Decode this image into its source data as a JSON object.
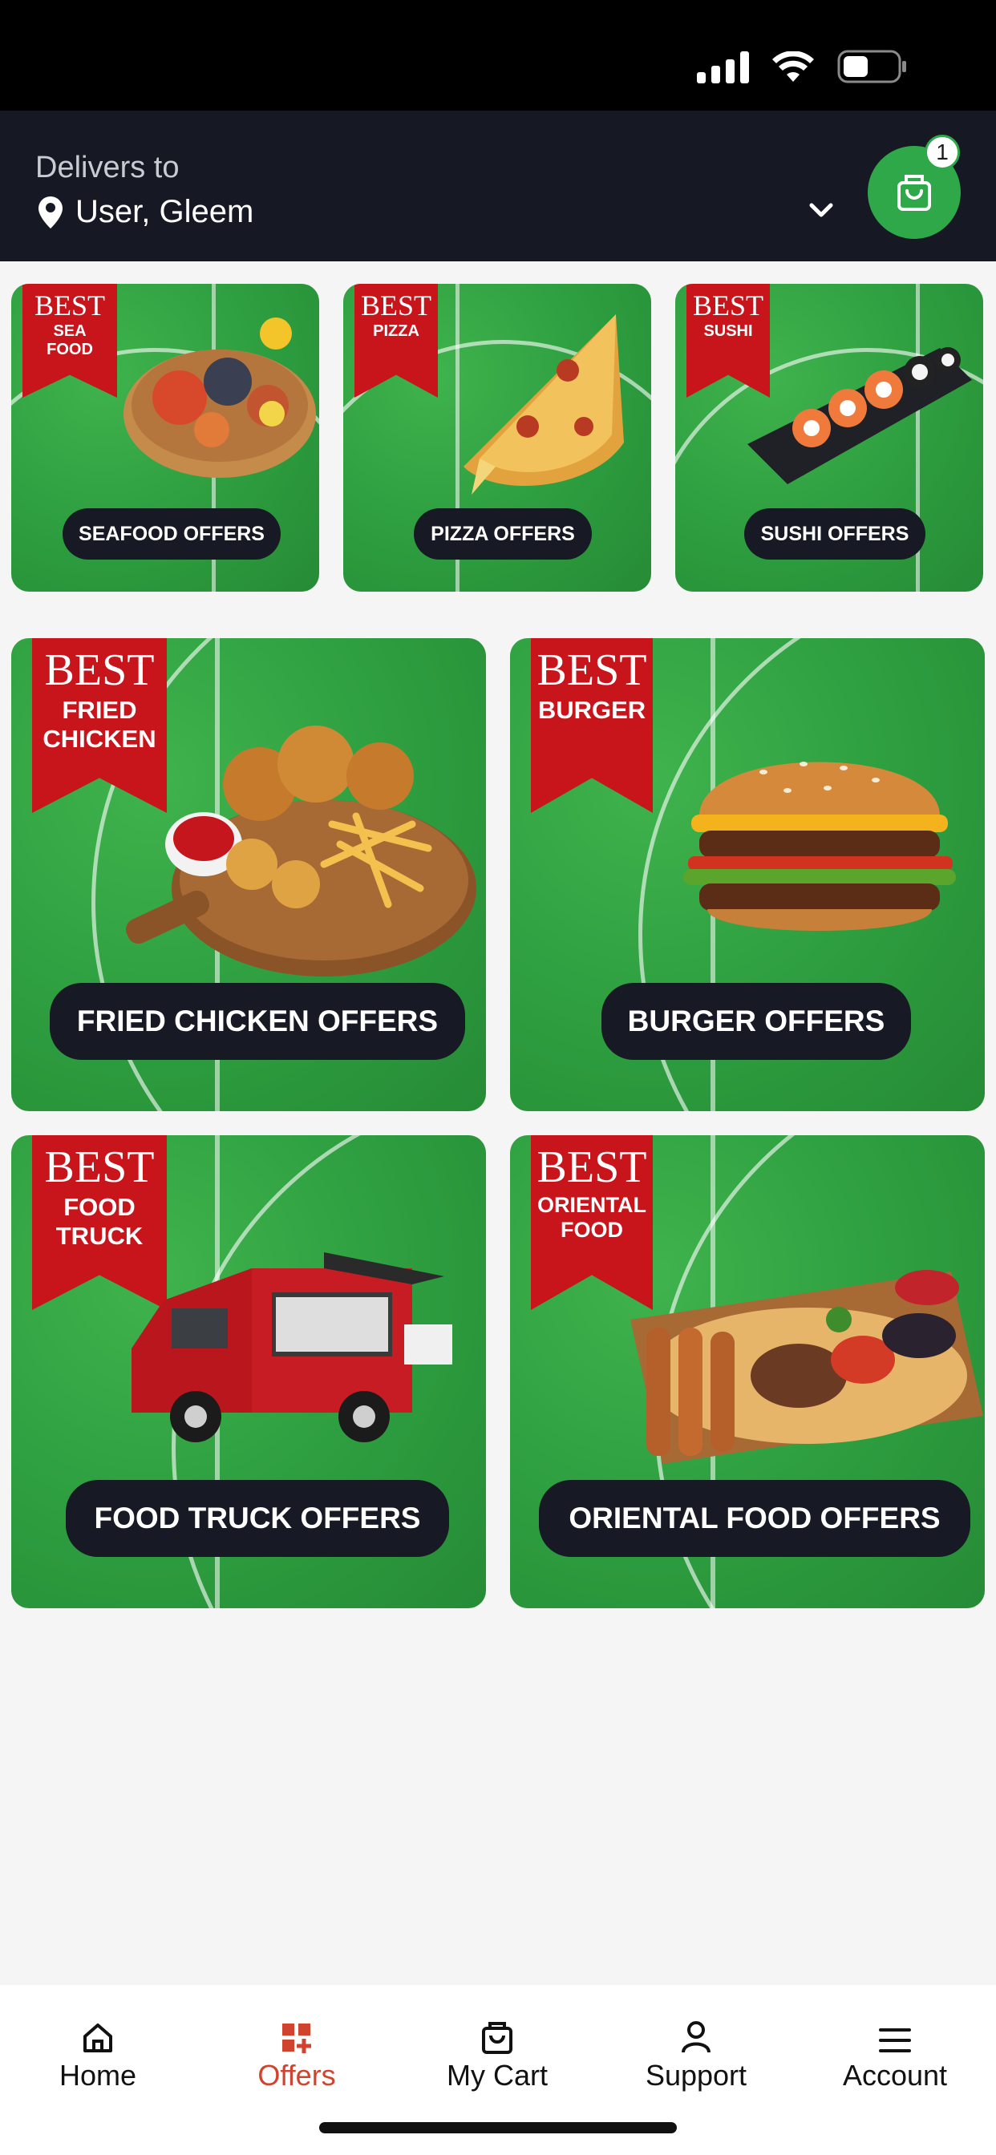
{
  "status_bar": {
    "battery_level": 0.45
  },
  "header": {
    "deliver_label": "Delivers to",
    "location": "User, Gleem",
    "cart_count": "1"
  },
  "offers_small": [
    {
      "ribbon_top": "BEST",
      "ribbon_sub": "SEA\nFOOD",
      "button": "SEAFOOD OFFERS",
      "image": "seafood-platter"
    },
    {
      "ribbon_top": "BEST",
      "ribbon_sub": "PIZZA",
      "button": "PIZZA OFFERS",
      "image": "pizza-slice"
    },
    {
      "ribbon_top": "BEST",
      "ribbon_sub": "SUSHI",
      "button": "SUSHI OFFERS",
      "image": "sushi-board"
    }
  ],
  "offers_large": [
    {
      "ribbon_top": "BEST",
      "ribbon_sub": "FRIED\nCHICKEN",
      "button": "FRIED CHICKEN OFFERS",
      "image": "fried-chicken-board"
    },
    {
      "ribbon_top": "BEST",
      "ribbon_sub": "BURGER",
      "button": "BURGER OFFERS",
      "image": "burger"
    },
    {
      "ribbon_top": "BEST",
      "ribbon_sub": "FOOD\nTRUCK",
      "button": "FOOD TRUCK OFFERS",
      "image": "food-truck"
    },
    {
      "ribbon_top": "BEST",
      "ribbon_sub": "ORIENTAL\nFOOD",
      "button": "ORIENTAL FOOD OFFERS",
      "image": "grill-platter"
    }
  ],
  "tabs": [
    {
      "label": "Home",
      "icon": "home-icon",
      "active": false
    },
    {
      "label": "Offers",
      "icon": "offers-icon",
      "active": true
    },
    {
      "label": "My Cart",
      "icon": "cart-icon",
      "active": false
    },
    {
      "label": "Support",
      "icon": "support-icon",
      "active": false
    },
    {
      "label": "Account",
      "icon": "menu-icon",
      "active": false
    }
  ],
  "colors": {
    "accent_green": "#2fa84a",
    "header_bg": "#161924",
    "ribbon_red": "#c8141b",
    "active_tab": "#d0432e"
  }
}
